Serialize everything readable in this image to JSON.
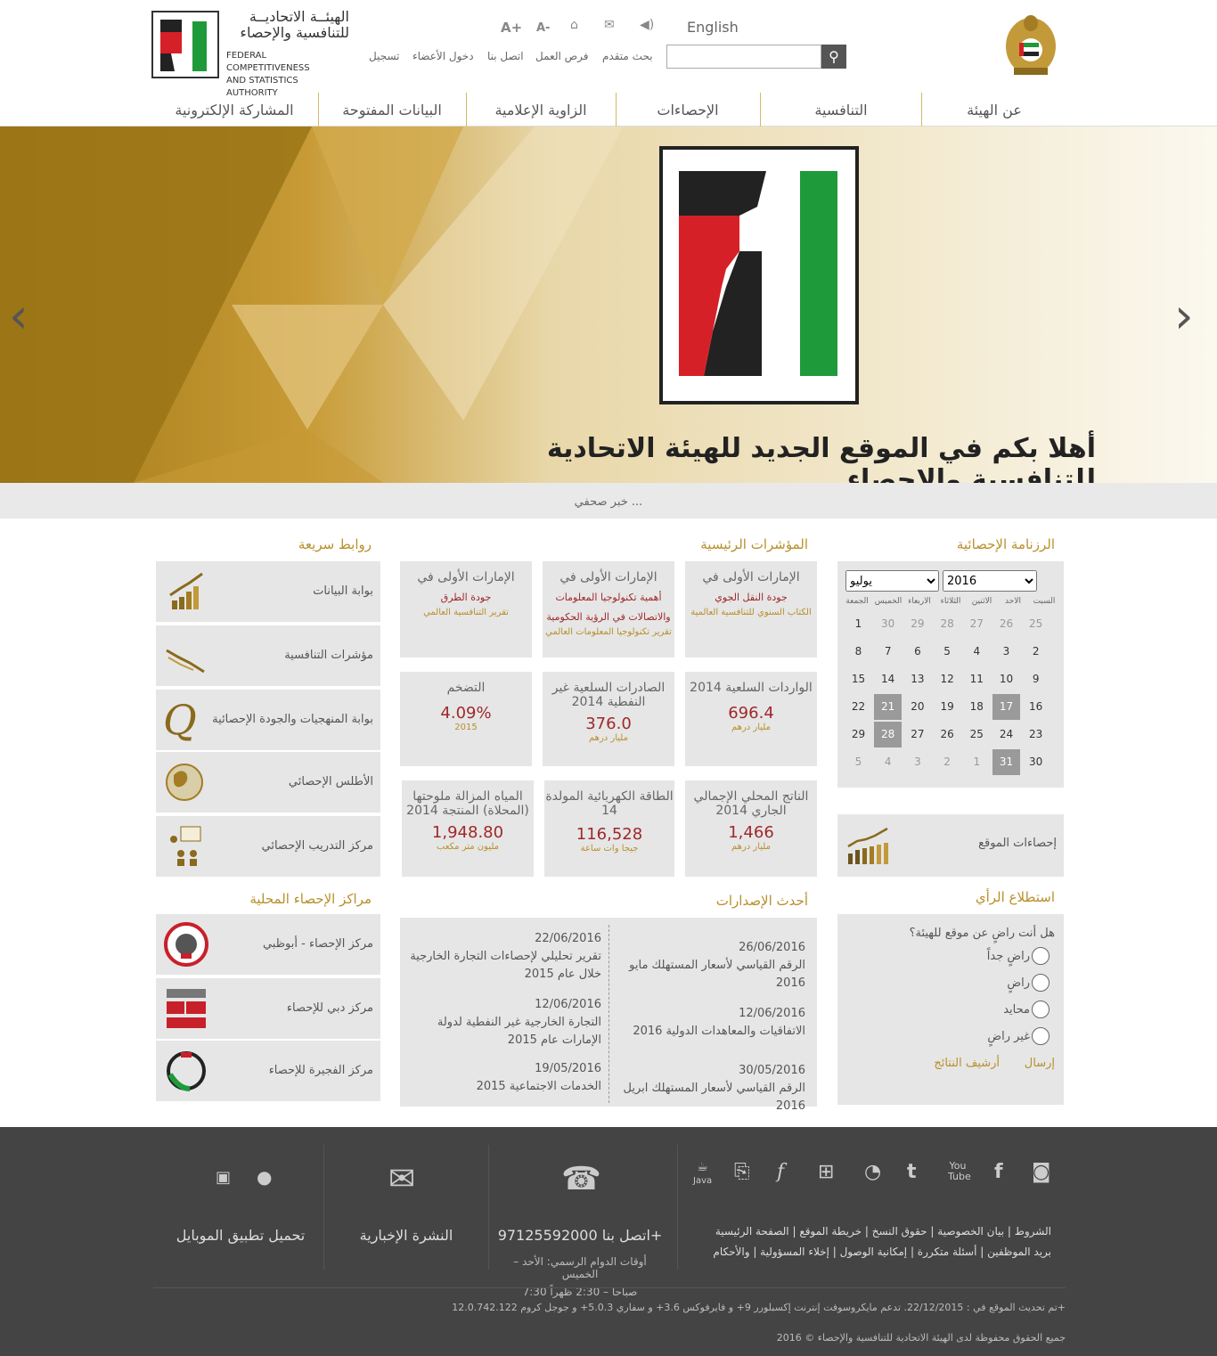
{
  "header": {
    "logo_ar_line1": "الهيئــة الاتحاديــة",
    "logo_ar_line2": "للتنافسية والإحصاء",
    "logo_en_line1": "FEDERAL COMPETITIVENESS",
    "logo_en_line2": "AND STATISTICS AUTHORITY",
    "language_toggle": "English",
    "font_increase": "A+",
    "font_decrease": "A-",
    "util_links": [
      "بحث متقدم",
      "فرص العمل",
      "اتصل بنا",
      "دخول الأعضاء",
      "تسجيل"
    ],
    "search_placeholder": ""
  },
  "nav": [
    "عن الهيئة",
    "التنافسية",
    "الإحصاءات",
    "الزاوية الإعلامية",
    "البيانات المفتوحة",
    "المشاركة الإلكترونية"
  ],
  "hero": {
    "caption": "أهلا بكم في الموقع الجديد للهيئة الاتحادية للتنافسية والإحصاء"
  },
  "news_ticker": "خبر صحفي ...",
  "calendar": {
    "title": "الرزنامة الإحصائية",
    "year": "2016",
    "month": "يوليو",
    "weekdays": [
      "الجمعة",
      "الخميس",
      "الاربعاء",
      "الثلاثاء",
      "الاثنين",
      "الاحد",
      "السبت"
    ],
    "rows": [
      [
        "1",
        "30",
        "29",
        "28",
        "27",
        "26",
        "25"
      ],
      [
        "8",
        "7",
        "6",
        "5",
        "4",
        "3",
        "2"
      ],
      [
        "15",
        "14",
        "13",
        "12",
        "11",
        "10",
        "9"
      ],
      [
        "22",
        "21",
        "20",
        "19",
        "18",
        "17",
        "16"
      ],
      [
        "29",
        "28",
        "27",
        "26",
        "25",
        "24",
        "23"
      ],
      [
        "5",
        "4",
        "3",
        "2",
        "1",
        "31",
        "30"
      ]
    ]
  },
  "indicators": {
    "title": "المؤشرات الرئيسية",
    "top": [
      {
        "title": "الإمارات الأولى في",
        "sub": "جودة النقل الجوي",
        "src": "الكتاب السنوي للتنافسية العالمية"
      },
      {
        "title": "الإمارات الأولى في",
        "sub": "أهمية تكنولوجيا المعلومات والاتصالات في الرؤية الحكومية",
        "src": "تقرير تكنولوجيا المعلومات العالمي"
      },
      {
        "title": "الإمارات الأولى في",
        "sub": "جودة الطرق",
        "src": "تقرير التنافسية العالمي"
      }
    ],
    "middle": [
      {
        "title": "الواردات السلعية 2014",
        "value": "696.4",
        "unit": "مليار درهم"
      },
      {
        "title": "الصادرات السلعية غير النفطية 2014",
        "value": "376.0",
        "unit": "مليار درهم"
      },
      {
        "title": "التضخم",
        "value": "4.09%",
        "unit": "2015"
      }
    ],
    "bottom": [
      {
        "title": "الناتج المحلي الإجمالي الجاري 2014",
        "value": "1,466",
        "unit": "مليار درهم"
      },
      {
        "title": "الطاقة الكهربائية المولدة 14",
        "value": "116,528",
        "unit": "جيجا وات ساعة"
      },
      {
        "title": "المياه المزالة ملوحتها (المحلاة) المنتجة 2014",
        "value": "1,948.80",
        "unit": "مليون متر مكعب"
      }
    ]
  },
  "quick_links": {
    "title": "روابط سريعة",
    "items": [
      "بوابة البيانات",
      "مؤشرات التنافسية",
      "بوابة المنهجيات والجودة الإحصائية",
      "الأطلس الإحصائي",
      "مركز التدريب الإحصائي"
    ]
  },
  "site_stats": "إحصاءات الموقع",
  "publications": {
    "title": "أحدث الإصدارات",
    "right": [
      {
        "date": "26/06/2016",
        "text": "الرقم القياسي لأسعار المستهلك مايو 2016"
      },
      {
        "date": "12/06/2016",
        "text": "الاتفاقيات والمعاهدات الدولية 2016"
      },
      {
        "date": "30/05/2016",
        "text": "الرقم القياسي لأسعار المستهلك ابريل 2016"
      }
    ],
    "left": [
      {
        "date": "22/06/2016",
        "text": "تقرير تحليلي لإحصاءات التجارة الخارجية خلال عام 2015"
      },
      {
        "date": "12/06/2016",
        "text": "التجارة الخارجية غير النفطية لدولة الإمارات عام 2015"
      },
      {
        "date": "19/05/2016",
        "text": "الخدمات الاجتماعية 2015"
      }
    ]
  },
  "local_centers": {
    "title": "مراكز الإحصاء المحلية",
    "items": [
      "مركز الإحصاء - أبوظبي",
      "مركز دبي للإحصاء",
      "مركز الفجيرة للإحصاء"
    ]
  },
  "poll": {
    "title": "استطلاع الرأي",
    "question": "هل أنت راضٍ عن موقع للهيئة؟",
    "options": [
      "راضٍ جداً",
      "راضٍ",
      "محايد",
      "غير راضٍ"
    ],
    "submit": "إرسال",
    "archive": "أرشيف النتائج"
  },
  "footer": {
    "mobile_app": "تحميل تطبيق الموبايل",
    "newsletter": "النشرة الإخبارية",
    "contact": "اتصل بنا 97125592000+",
    "hours_line1": "أوقات الدوام الرسمي: الأحد – الخميس",
    "hours_line2": "7:30 صباحا – 2:30 ظهراً",
    "links_row1": [
      "الصفحة الرئيسية",
      "خريطة الموقع",
      "حقوق النسخ",
      "بيان الخصوصية",
      "الشروط"
    ],
    "links_row2": [
      "والأحكام",
      "إخلاء المسؤولية",
      "إمكانية الوصول",
      "أسئلة متكررة",
      "بريد الموظفين"
    ],
    "updated": "تم تحديث الموقع في : 22/12/2015. تدعم مايكروسوفت إنترنت إكسبلورر 9+ و فايرفوكس 3.6+ و سفاري 5.0.3+ و جوجل كروم 12.0.742.122+",
    "copyright": "جميع الحقوق محفوظة لدى الهيئة الاتحادية للتنافسية والإحصاء © 2016",
    "youtube_label": "You Tube",
    "java_label": "Java"
  }
}
